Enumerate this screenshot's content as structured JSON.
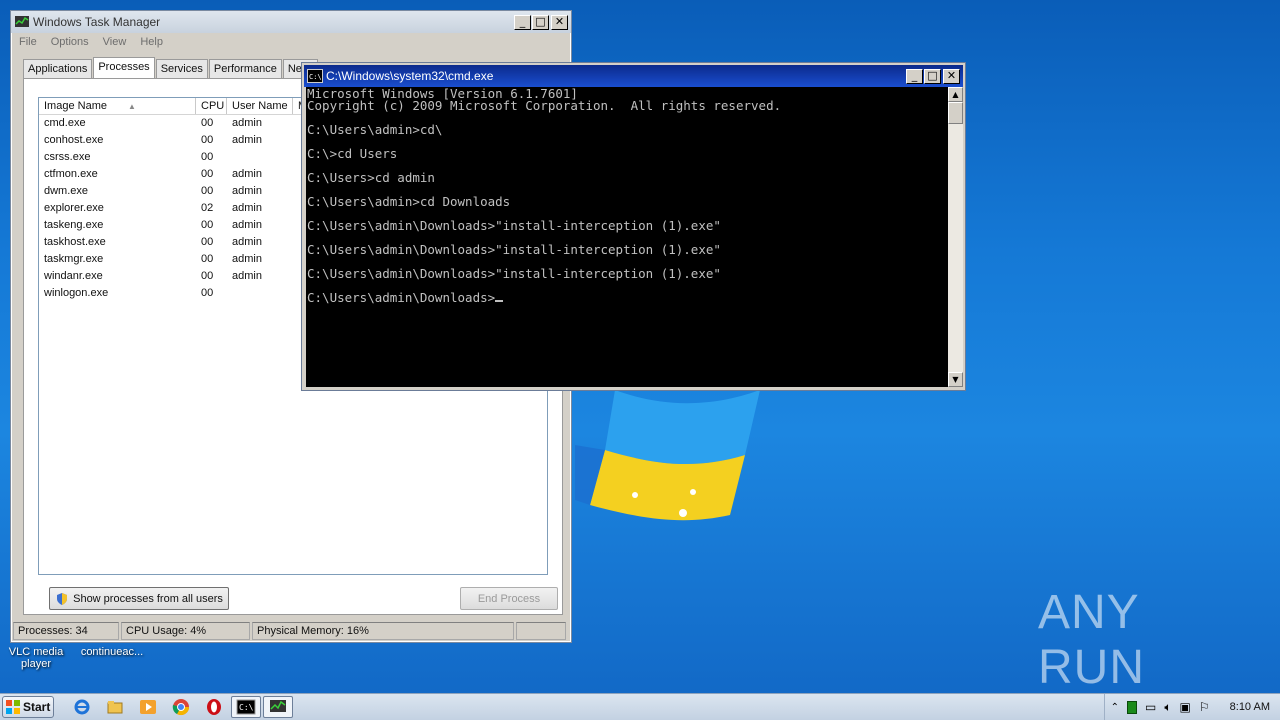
{
  "desktop": {
    "icon_labels": [
      "VLC media player",
      "continueac..."
    ],
    "watermark": "ANY RUN"
  },
  "task_manager": {
    "title": "Windows Task Manager",
    "menu": [
      "File",
      "Options",
      "View",
      "Help"
    ],
    "tabs": [
      "Applications",
      "Processes",
      "Services",
      "Performance",
      "Netw"
    ],
    "active_tab": "Processes",
    "columns": [
      "Image Name",
      "CPU",
      "User Name",
      "M"
    ],
    "processes": [
      {
        "name": "cmd.exe",
        "cpu": "00",
        "user": "admin"
      },
      {
        "name": "conhost.exe",
        "cpu": "00",
        "user": "admin"
      },
      {
        "name": "csrss.exe",
        "cpu": "00",
        "user": ""
      },
      {
        "name": "ctfmon.exe",
        "cpu": "00",
        "user": "admin"
      },
      {
        "name": "dwm.exe",
        "cpu": "00",
        "user": "admin"
      },
      {
        "name": "explorer.exe",
        "cpu": "02",
        "user": "admin"
      },
      {
        "name": "taskeng.exe",
        "cpu": "00",
        "user": "admin"
      },
      {
        "name": "taskhost.exe",
        "cpu": "00",
        "user": "admin"
      },
      {
        "name": "taskmgr.exe",
        "cpu": "00",
        "user": "admin"
      },
      {
        "name": "windanr.exe",
        "cpu": "00",
        "user": "admin"
      },
      {
        "name": "winlogon.exe",
        "cpu": "00",
        "user": ""
      }
    ],
    "show_all_label": "Show processes from all users",
    "end_process_label": "End Process",
    "status": {
      "processes": "Processes: 34",
      "cpu": "CPU Usage: 4%",
      "memory": "Physical Memory: 16%"
    }
  },
  "cmd": {
    "title": "C:\\Windows\\system32\\cmd.exe",
    "lines": [
      "Microsoft Windows [Version 6.1.7601]",
      "Copyright (c) 2009 Microsoft Corporation.  All rights reserved.",
      "",
      "C:\\Users\\admin>cd\\",
      "",
      "C:\\>cd Users",
      "",
      "C:\\Users>cd admin",
      "",
      "C:\\Users\\admin>cd Downloads",
      "",
      "C:\\Users\\admin\\Downloads>\"install-interception (1).exe\"",
      "",
      "C:\\Users\\admin\\Downloads>\"install-interception (1).exe\"",
      "",
      "C:\\Users\\admin\\Downloads>\"install-interception (1).exe\"",
      "",
      "C:\\Users\\admin\\Downloads>"
    ]
  },
  "taskbar": {
    "start_label": "Start",
    "clock": "8:10 AM"
  }
}
